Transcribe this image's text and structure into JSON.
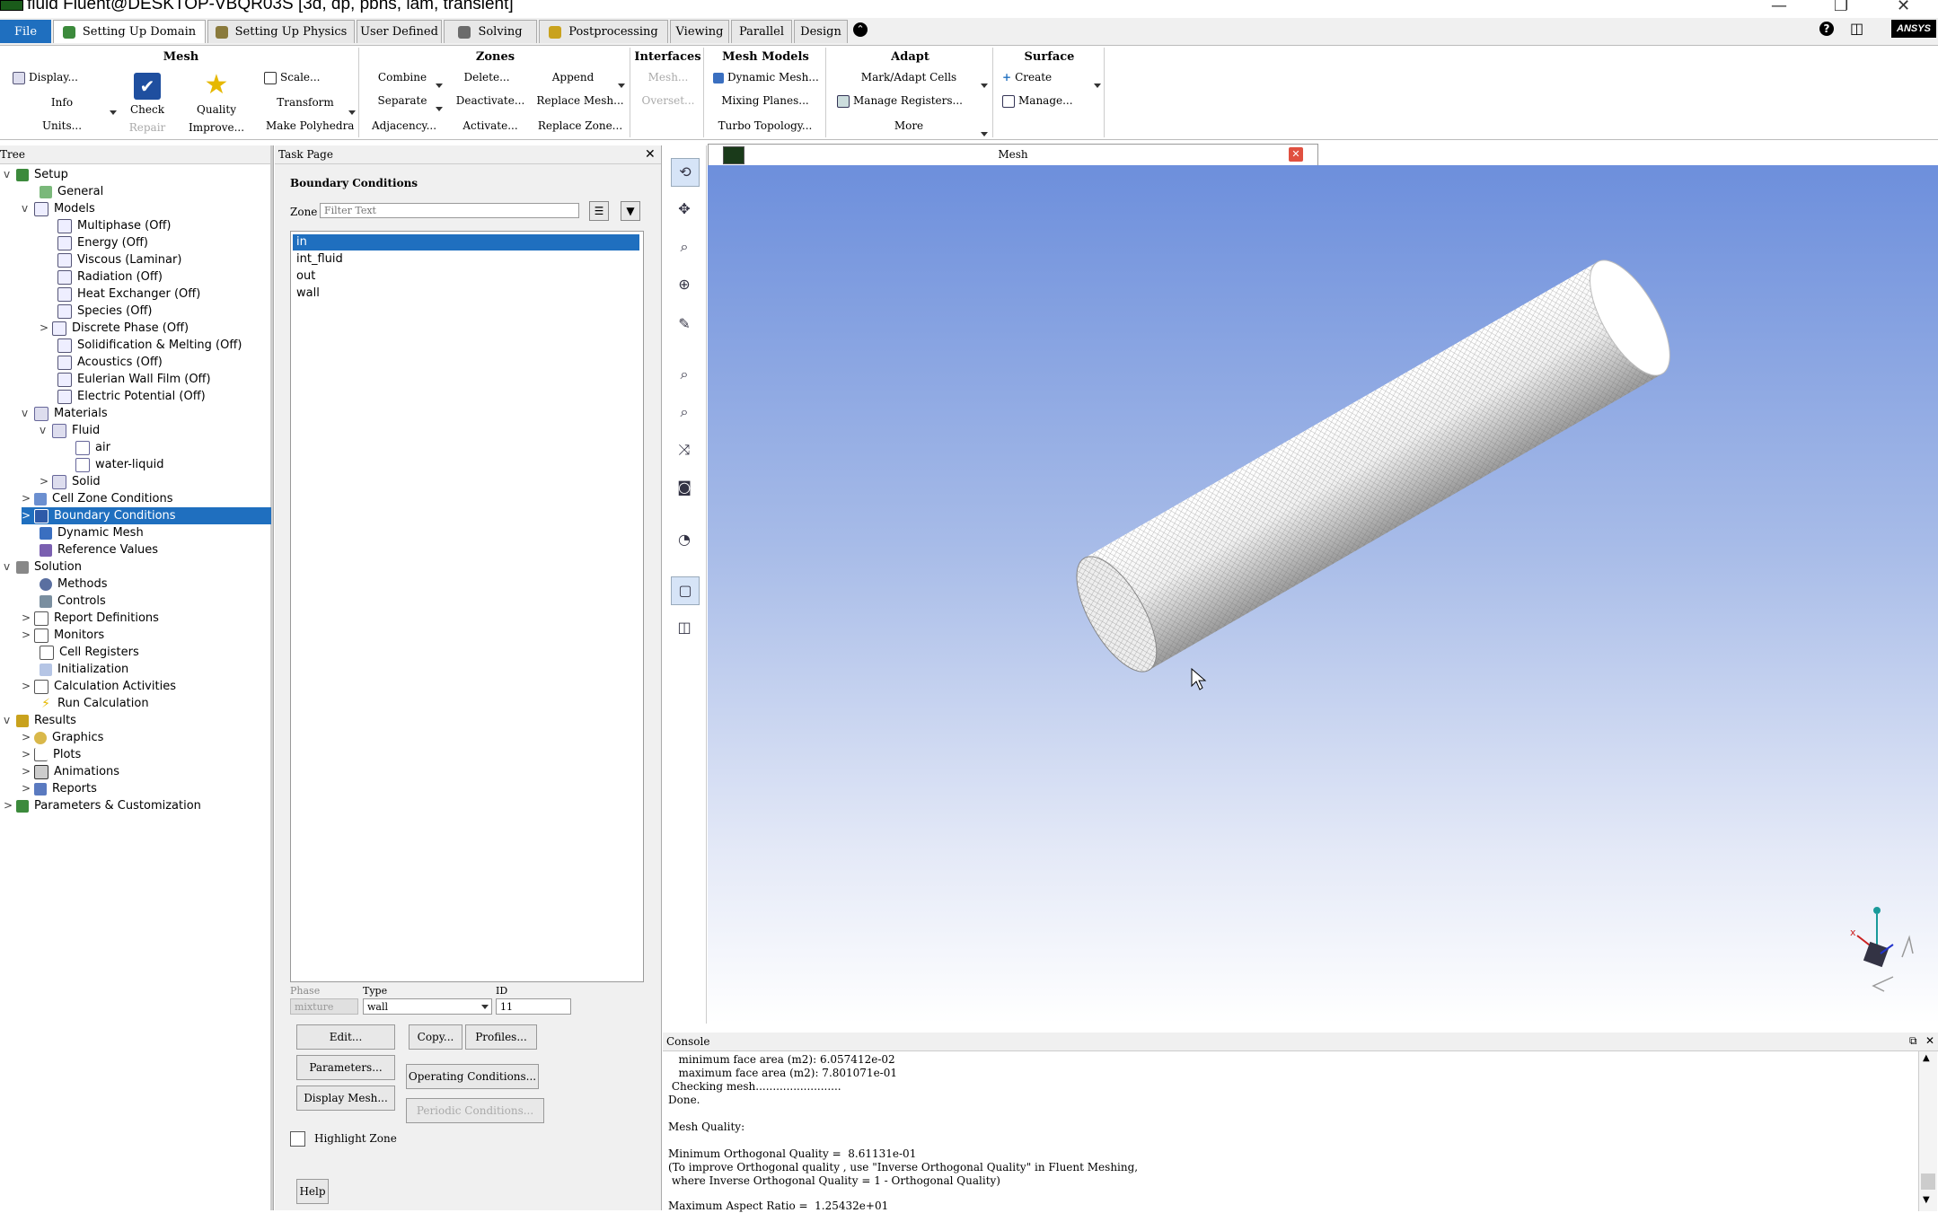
{
  "window": {
    "title": "fluid Fluent@DESKTOP-VBQR03S  [3d, dp, pbns, lam, transient]"
  },
  "tabs": [
    {
      "label": "File"
    },
    {
      "label": "Setting Up Domain"
    },
    {
      "label": "Setting Up Physics"
    },
    {
      "label": "User Defined"
    },
    {
      "label": "Solving"
    },
    {
      "label": "Postprocessing"
    },
    {
      "label": "Viewing"
    },
    {
      "label": "Parallel"
    },
    {
      "label": "Design"
    }
  ],
  "brand": "ANSYS",
  "ribbon": {
    "mesh": {
      "title": "Mesh",
      "display": "Display...",
      "info": "Info",
      "units": "Units...",
      "check": "Check",
      "repair": "Repair",
      "quality": "Quality",
      "improve": "Improve...",
      "scale": "Scale...",
      "transform": "Transform",
      "make_polyhedra": "Make Polyhedra"
    },
    "zones": {
      "title": "Zones",
      "combine": "Combine",
      "separate": "Separate",
      "adjacency": "Adjacency...",
      "delete": "Delete...",
      "deactivate": "Deactivate...",
      "activate": "Activate...",
      "append": "Append",
      "replace_mesh": "Replace Mesh...",
      "replace_zone": "Replace Zone..."
    },
    "interfaces": {
      "title": "Interfaces",
      "mesh": "Mesh...",
      "overset": "Overset..."
    },
    "mesh_models": {
      "title": "Mesh Models",
      "dynamic_mesh": "Dynamic Mesh...",
      "mixing_planes": "Mixing Planes...",
      "turbo_topology": "Turbo Topology..."
    },
    "adapt": {
      "title": "Adapt",
      "mark_adapt": "Mark/Adapt Cells",
      "manage_registers": "Manage Registers...",
      "more": "More"
    },
    "surface": {
      "title": "Surface",
      "create": "Create",
      "manage": "Manage..."
    }
  },
  "tree": {
    "header": "Tree",
    "items": [
      {
        "label": "Setup"
      },
      {
        "label": "General"
      },
      {
        "label": "Models"
      },
      {
        "label": "Multiphase (Off)"
      },
      {
        "label": "Energy (Off)"
      },
      {
        "label": "Viscous (Laminar)"
      },
      {
        "label": "Radiation (Off)"
      },
      {
        "label": "Heat Exchanger (Off)"
      },
      {
        "label": "Species (Off)"
      },
      {
        "label": "Discrete Phase (Off)"
      },
      {
        "label": "Solidification & Melting (Off)"
      },
      {
        "label": "Acoustics (Off)"
      },
      {
        "label": "Eulerian Wall Film (Off)"
      },
      {
        "label": "Electric Potential (Off)"
      },
      {
        "label": "Materials"
      },
      {
        "label": "Fluid"
      },
      {
        "label": "air"
      },
      {
        "label": "water-liquid"
      },
      {
        "label": "Solid"
      },
      {
        "label": "Cell Zone Conditions"
      },
      {
        "label": "Boundary Conditions"
      },
      {
        "label": "Dynamic Mesh"
      },
      {
        "label": "Reference Values"
      },
      {
        "label": "Solution"
      },
      {
        "label": "Methods"
      },
      {
        "label": "Controls"
      },
      {
        "label": "Report Definitions"
      },
      {
        "label": "Monitors"
      },
      {
        "label": "Cell Registers"
      },
      {
        "label": "Initialization"
      },
      {
        "label": "Calculation Activities"
      },
      {
        "label": "Run Calculation"
      },
      {
        "label": "Results"
      },
      {
        "label": "Graphics"
      },
      {
        "label": "Plots"
      },
      {
        "label": "Animations"
      },
      {
        "label": "Reports"
      },
      {
        "label": "Parameters & Customization"
      }
    ]
  },
  "task_page": {
    "header": "Task Page",
    "title": "Boundary Conditions",
    "zone_label": "Zone",
    "filter_placeholder": "Filter Text",
    "zones": [
      {
        "label": "in"
      },
      {
        "label": "int_fluid"
      },
      {
        "label": "out"
      },
      {
        "label": "wall"
      }
    ],
    "phase_label": "Phase",
    "phase_value": "mixture",
    "type_label": "Type",
    "type_value": "wall",
    "id_label": "ID",
    "id_value": "11",
    "buttons": {
      "edit": "Edit...",
      "copy": "Copy...",
      "profiles": "Profiles...",
      "parameters": "Parameters...",
      "operating_conditions": "Operating Conditions...",
      "display_mesh": "Display Mesh...",
      "periodic_conditions": "Periodic Conditions...",
      "help": "Help"
    },
    "highlight_zone": "Highlight Zone"
  },
  "viewport": {
    "tab_label": "Mesh"
  },
  "console": {
    "header": "Console",
    "lines": [
      "   minimum face area (m2): 6.057412e-02",
      "   maximum face area (m2): 7.801071e-01",
      " Checking mesh.........................",
      "Done.",
      "",
      "Mesh Quality:",
      "",
      "Minimum Orthogonal Quality =  8.61131e-01",
      "(To improve Orthogonal quality , use \"Inverse Orthogonal Quality\" in Fluent Meshing,",
      " where Inverse Orthogonal Quality = 1 - Orthogonal Quality)",
      "",
      "Maximum Aspect Ratio =  1.25432e+01"
    ]
  },
  "colors": {
    "accent": "#1f6fbf",
    "viewport_top": "#6d8fdc",
    "viewport_bottom": "#ffffff"
  }
}
